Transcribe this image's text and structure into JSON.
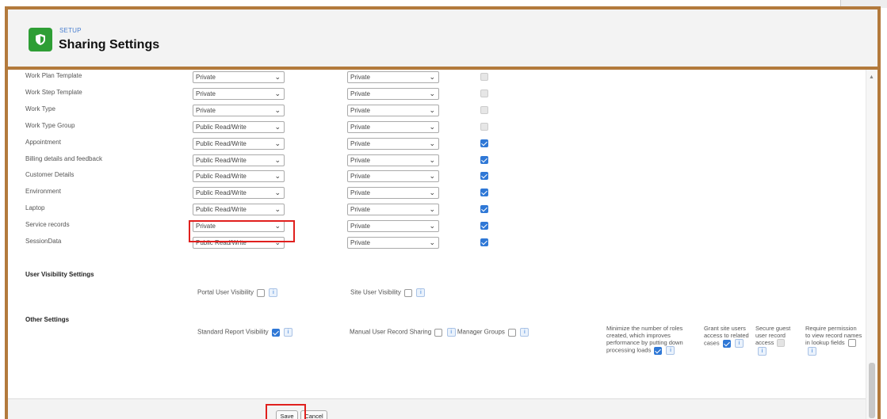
{
  "header": {
    "eyebrow": "SETUP",
    "title": "Sharing Settings"
  },
  "rows": [
    {
      "label": "Work Plan Template",
      "default_access": "Private",
      "external_access": "Private",
      "grant_hierarchy": "disabled"
    },
    {
      "label": "Work Step Template",
      "default_access": "Private",
      "external_access": "Private",
      "grant_hierarchy": "disabled"
    },
    {
      "label": "Work Type",
      "default_access": "Private",
      "external_access": "Private",
      "grant_hierarchy": "disabled"
    },
    {
      "label": "Work Type Group",
      "default_access": "Public Read/Write",
      "external_access": "Private",
      "grant_hierarchy": "disabled"
    },
    {
      "label": "Appointment",
      "default_access": "Public Read/Write",
      "external_access": "Private",
      "grant_hierarchy": "checked"
    },
    {
      "label": "Billing details and feedback",
      "default_access": "Public Read/Write",
      "external_access": "Private",
      "grant_hierarchy": "checked"
    },
    {
      "label": "Customer Details",
      "default_access": "Public Read/Write",
      "external_access": "Private",
      "grant_hierarchy": "checked"
    },
    {
      "label": "Environment",
      "default_access": "Public Read/Write",
      "external_access": "Private",
      "grant_hierarchy": "checked"
    },
    {
      "label": "Laptop",
      "default_access": "Public Read/Write",
      "external_access": "Private",
      "grant_hierarchy": "checked"
    },
    {
      "label": "Service records",
      "default_access": "Private",
      "external_access": "Private",
      "grant_hierarchy": "checked"
    },
    {
      "label": "SessionData",
      "default_access": "Public Read/Write",
      "external_access": "Private",
      "grant_hierarchy": "checked"
    }
  ],
  "user_visibility": {
    "heading": "User Visibility Settings",
    "portal_label": "Portal User Visibility",
    "site_label": "Site User Visibility"
  },
  "other_settings": {
    "heading": "Other Settings",
    "standard_report_label": "Standard Report Visibility",
    "manual_sharing_label": "Manual User Record Sharing",
    "manager_groups_label": "Manager Groups",
    "minimize_roles_label": "Minimize the number of roles created, which improves performance by putting down processing loads",
    "grant_site_label": "Grant site users access to related cases",
    "secure_guest_label": "Secure guest user record access",
    "require_permission_label": "Require permission to view record names in lookup fields"
  },
  "footer": {
    "save_label": "Save",
    "cancel_label": "Cancel"
  },
  "info_glyph": "i",
  "colors": {
    "frame": "#b37a3c",
    "highlight": "#e0201e",
    "checkbox": "#2f78d6",
    "logo": "#2e9e35"
  }
}
